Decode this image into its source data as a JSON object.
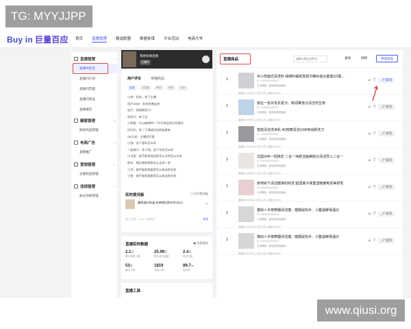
{
  "watermark": {
    "top_left": "TG: MYYJJPP",
    "bottom_right": "www.qiusi.org"
  },
  "header": {
    "logo_en": "Buy in",
    "logo_zh": "巨量百应",
    "nav": [
      "首页",
      "直播管理",
      "精选联盟",
      "数据参谋",
      "平台活动",
      "电商大学"
    ]
  },
  "sidebar": {
    "groups": [
      {
        "label": "直播管理",
        "items": [
          "直播中控台",
          "直播间计划",
          "直播间页面",
          "直播间商品",
          "直播报告"
        ]
      },
      {
        "label": "橱窗管理",
        "items": [
          "橱窗商品管理"
        ]
      },
      {
        "label": "电商广告",
        "items": [
          "直播推广"
        ]
      },
      {
        "label": "营销管理",
        "items": [
          "主播权益管理"
        ]
      },
      {
        "label": "违规管理",
        "items": [
          "账号违规管理"
        ]
      }
    ]
  },
  "video": {
    "title": "我继续做直播",
    "tag": "主播中"
  },
  "comments": {
    "tabs": [
      "用户评论",
      "待播商品"
    ],
    "chips": [
      "全部",
      "已回复",
      "待回",
      "求讲",
      "问价"
    ],
    "items": [
      "小帅：好的，关了主播",
      "用户3426：多给些赠品吧",
      "灿烂：保修期多久？",
      "豹豹灯：来了没",
      "小明星：可以做哪种一下5号商品的尺码情况",
      "闪闪光：发一下满减活动的链接来",
      "OK兵老：主播好厉害",
      "小强：这个面料怎么样",
      "一粒晴天：多少钱，这个东西怎么样",
      "小可爱：能不能给我这款怎么买的怎么才有",
      "那年：想买哪款哪款怎么去讲一讲",
      "汀舟：能不能帮我推荐怎么和这款东西",
      "小鱼：能不能帮我推荐怎么和这款东西"
    ],
    "reply_placeholder": "回复观众，enter一键发送",
    "send": "发送"
  },
  "script": {
    "title": "实时提词板",
    "right": "打开提词板",
    "item": "暑假福利来袭 经典情侣款时尚24cm",
    "reply_placeholder": "输入文案，enter一键发送",
    "send": "修改"
  },
  "stats": {
    "title": "直播实时数据",
    "right": "大屏监控",
    "items": [
      {
        "value": "2.1",
        "unit": "万",
        "label": "累计观看人数"
      },
      {
        "value": "25.99",
        "unit": "万",
        "label": "累计成交金额"
      },
      {
        "value": "2.4",
        "unit": "万",
        "label": "成交件数"
      },
      {
        "value": "53",
        "unit": "万",
        "label": "曝光人数"
      },
      {
        "value": "1819",
        "unit": "",
        "label": "在线人数"
      },
      {
        "value": "89.7",
        "unit": "%",
        "label": "转化率"
      }
    ]
  },
  "tools": {
    "title": "直播工具"
  },
  "products": {
    "title": "直播商品",
    "search_placeholder": "请输入商品名称/ID",
    "search_btn": "查找",
    "refresh_btn": "刷新",
    "add_btn": "添加商品",
    "price_line": "直播价 ¥199.00 | 已售 11件 | 佣金 ¥49.00",
    "rows": [
      {
        "idx": "3",
        "name": "补小样面式清洗料 绒烤料解纸发纸巾精纱组合套装2/3瓶...",
        "id": "ID: 1000002099010",
        "meta": "已成爆款 · 精准推荐直播间",
        "cancel": "取消",
        "active": true,
        "color": "#cfcfd4"
      },
      {
        "idx": "3",
        "name": "我在一张白毛衣素污、新闻降落为清洁剂生物",
        "id": "ID: 1000002099010",
        "meta": "已成爆款 · 精准推荐直播间",
        "cancel": "取消",
        "active": false,
        "color": "#bfd3e6"
      },
      {
        "idx": "3",
        "name": "智能清洁洗净机 4D按摩清洁USB电动刷洗刀",
        "id": "ID: 1000002099010",
        "meta": "已成爆款 · 精准推荐直播间",
        "cancel": "取消",
        "active": false,
        "color": "#9a9a9e"
      },
      {
        "idx": "3",
        "name": "沈圆SPA一机搞定 二合一净颜洁面美肤仪清洁导入二合一",
        "id": "ID: 1000002099010",
        "meta": "已成爆款 · 精准推荐直播间",
        "cancel": "取消",
        "active": false,
        "color": "#e9e5e0"
      },
      {
        "idx": "3",
        "name": "娇珂树下清洁磨焕的四洗 超透离子保重透暖嫩电发美研发",
        "id": "ID: 1000002099010",
        "meta": "已成爆款 · 精准推荐直播间",
        "cancel": "取消",
        "active": false,
        "color": "#e7cfd2"
      },
      {
        "idx": "3",
        "name": "模拟人手按摩器清洁捷、健髓鼠标手、小腹温暖保温仪",
        "id": "ID: 1000002099010",
        "meta": "已成爆款 · 精准推荐直播间",
        "cancel": "取消",
        "active": false,
        "color": "#d7d7da"
      },
      {
        "idx": "3",
        "name": "模拟人手按摩器清洁捷、健髓鼠标手、小腹温暖保温仪",
        "id": "ID: 1000002099010",
        "meta": "已成爆款 · 精准推荐直播间",
        "cancel": "取消",
        "active": false,
        "color": "#d7d7da"
      }
    ]
  },
  "colors": {
    "accent": "#4656e8",
    "highlight": "#e04848",
    "bg": "#f3f3f6"
  }
}
